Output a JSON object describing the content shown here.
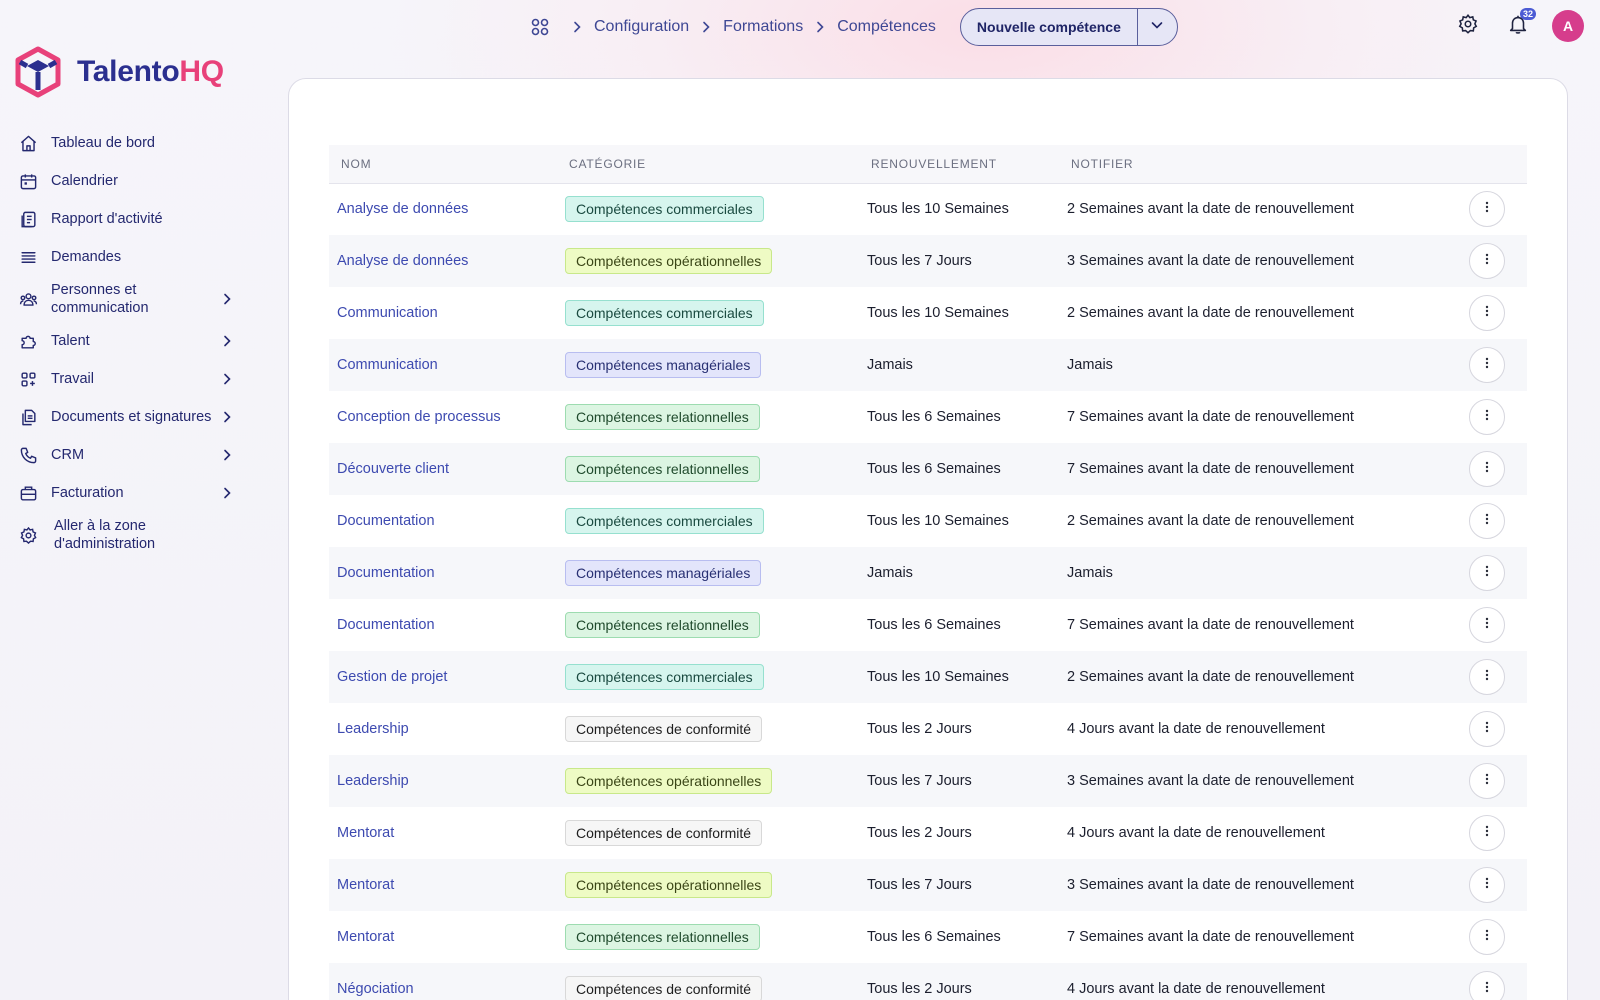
{
  "brand": {
    "part1": "Talento",
    "part2": "HQ",
    "color1": "#2b2f8f",
    "color2": "#e8417a"
  },
  "sidebar": {
    "items": [
      {
        "label": "Tableau de bord",
        "icon": "home-icon",
        "chevron": false
      },
      {
        "label": "Calendrier",
        "icon": "calendar-icon",
        "chevron": false
      },
      {
        "label": "Rapport d'activité",
        "icon": "report-icon",
        "chevron": false
      },
      {
        "label": "Demandes",
        "icon": "list-icon",
        "chevron": false
      },
      {
        "label": "Personnes et communication",
        "icon": "people-icon",
        "chevron": true
      },
      {
        "label": "Talent",
        "icon": "puzzle-icon",
        "chevron": true
      },
      {
        "label": "Travail",
        "icon": "apps-icon",
        "chevron": true
      },
      {
        "label": "Documents et signatures",
        "icon": "documents-icon",
        "chevron": true
      },
      {
        "label": "CRM",
        "icon": "phone-icon",
        "chevron": true
      },
      {
        "label": "Facturation",
        "icon": "briefcase-icon",
        "chevron": true
      },
      {
        "label": "Aller à la zone d'administration",
        "icon": "gear-icon",
        "chevron": false
      }
    ]
  },
  "breadcrumb": {
    "home_icon": "grid-icon",
    "items": [
      "Configuration",
      "Formations",
      "Compétences"
    ]
  },
  "actions": {
    "new_label": "Nouvelle compétence"
  },
  "notifications": {
    "count": "32"
  },
  "user": {
    "initial": "A",
    "color": "#d63d8c"
  },
  "table": {
    "headers": {
      "name": "NOM",
      "category": "CATÉGORIE",
      "renewal": "RENOUVELLEMENT",
      "notify": "NOTIFIER"
    },
    "rows": [
      {
        "name": "Analyse de données",
        "category": "Compétences commerciales",
        "cat_key": "commerciales",
        "renewal": "Tous les 10 Semaines",
        "notify": "2 Semaines avant la date de renouvellement"
      },
      {
        "name": "Analyse de données",
        "category": "Compétences opérationnelles",
        "cat_key": "operationnelles",
        "renewal": "Tous les 7 Jours",
        "notify": "3 Semaines avant la date de renouvellement"
      },
      {
        "name": "Communication",
        "category": "Compétences commerciales",
        "cat_key": "commerciales",
        "renewal": "Tous les 10 Semaines",
        "notify": "2 Semaines avant la date de renouvellement"
      },
      {
        "name": "Communication",
        "category": "Compétences managériales",
        "cat_key": "manageriales",
        "renewal": "Jamais",
        "notify": "Jamais"
      },
      {
        "name": "Conception de processus",
        "category": "Compétences relationnelles",
        "cat_key": "relationnelles",
        "renewal": "Tous les 6 Semaines",
        "notify": "7 Semaines avant la date de renouvellement"
      },
      {
        "name": "Découverte client",
        "category": "Compétences relationnelles",
        "cat_key": "relationnelles",
        "renewal": "Tous les 6 Semaines",
        "notify": "7 Semaines avant la date de renouvellement"
      },
      {
        "name": "Documentation",
        "category": "Compétences commerciales",
        "cat_key": "commerciales",
        "renewal": "Tous les 10 Semaines",
        "notify": "2 Semaines avant la date de renouvellement"
      },
      {
        "name": "Documentation",
        "category": "Compétences managériales",
        "cat_key": "manageriales",
        "renewal": "Jamais",
        "notify": "Jamais"
      },
      {
        "name": "Documentation",
        "category": "Compétences relationnelles",
        "cat_key": "relationnelles",
        "renewal": "Tous les 6 Semaines",
        "notify": "7 Semaines avant la date de renouvellement"
      },
      {
        "name": "Gestion de projet",
        "category": "Compétences commerciales",
        "cat_key": "commerciales",
        "renewal": "Tous les 10 Semaines",
        "notify": "2 Semaines avant la date de renouvellement"
      },
      {
        "name": "Leadership",
        "category": "Compétences de conformité",
        "cat_key": "conformite",
        "renewal": "Tous les 2 Jours",
        "notify": "4 Jours avant la date de renouvellement"
      },
      {
        "name": "Leadership",
        "category": "Compétences opérationnelles",
        "cat_key": "operationnelles",
        "renewal": "Tous les 7 Jours",
        "notify": "3 Semaines avant la date de renouvellement"
      },
      {
        "name": "Mentorat",
        "category": "Compétences de conformité",
        "cat_key": "conformite",
        "renewal": "Tous les 2 Jours",
        "notify": "4 Jours avant la date de renouvellement"
      },
      {
        "name": "Mentorat",
        "category": "Compétences opérationnelles",
        "cat_key": "operationnelles",
        "renewal": "Tous les 7 Jours",
        "notify": "3 Semaines avant la date de renouvellement"
      },
      {
        "name": "Mentorat",
        "category": "Compétences relationnelles",
        "cat_key": "relationnelles",
        "renewal": "Tous les 6 Semaines",
        "notify": "7 Semaines avant la date de renouvellement"
      },
      {
        "name": "Négociation",
        "category": "Compétences de conformité",
        "cat_key": "conformite",
        "renewal": "Tous les 2 Jours",
        "notify": "4 Jours avant la date de renouvellement"
      }
    ]
  }
}
